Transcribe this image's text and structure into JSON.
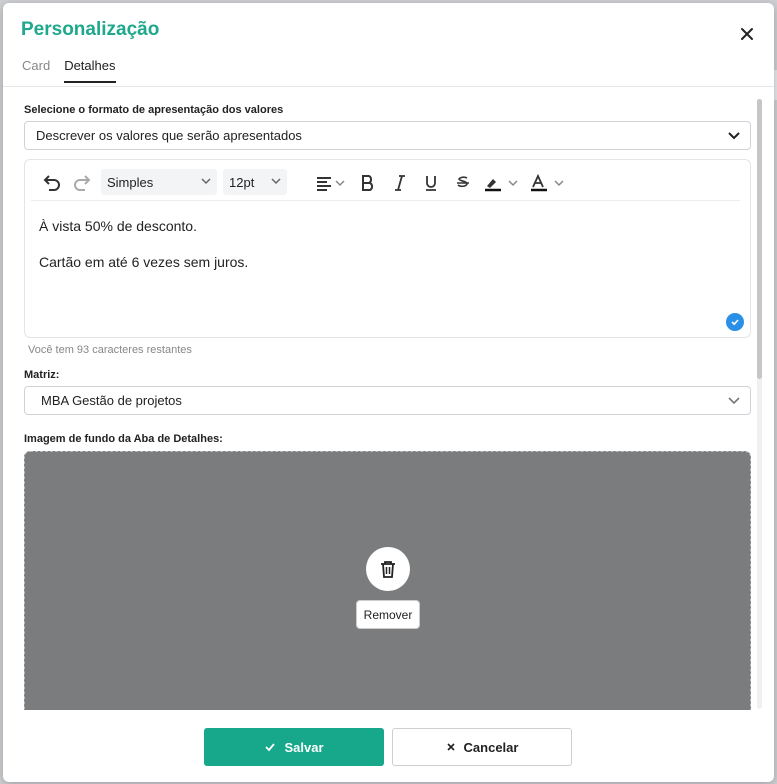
{
  "modal": {
    "title": "Personalização",
    "tabs": [
      {
        "label": "Card",
        "active": false
      },
      {
        "label": "Detalhes",
        "active": true
      }
    ]
  },
  "format": {
    "label": "Selecione o formato de apresentação dos valores",
    "value": "Descrever os valores que serão apresentados"
  },
  "editor": {
    "font_family": "Simples",
    "font_size": "12pt",
    "lines": [
      "À vista 50% de desconto.",
      "Cartão em até 6 vezes sem juros."
    ],
    "remaining_hint": "Você tem 93 caracteres restantes"
  },
  "matrix": {
    "label": "Matriz:",
    "value": "MBA Gestão de projetos"
  },
  "background": {
    "label": "Imagem de fundo da Aba de Detalhes:",
    "remove_label": "Remover"
  },
  "footer": {
    "save_label": "Salvar",
    "cancel_label": "Cancelar"
  },
  "colors": {
    "accent": "#17a88b",
    "title": "#1fa88d",
    "check": "#2a8fe6"
  }
}
